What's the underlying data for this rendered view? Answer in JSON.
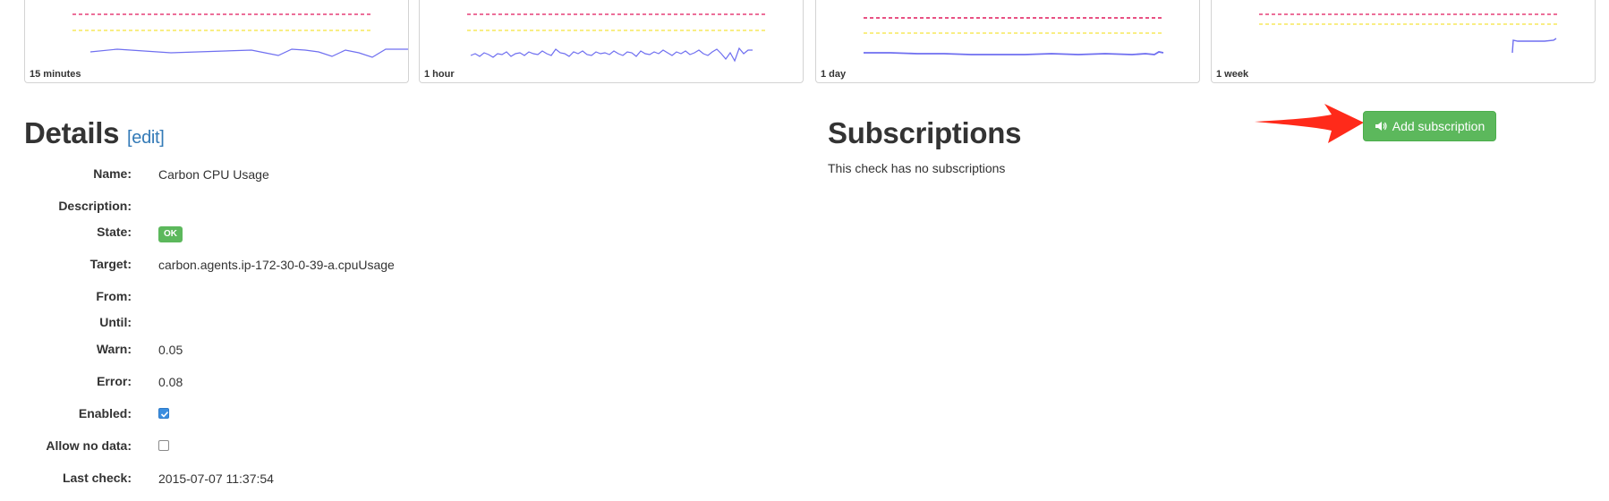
{
  "sparklines": [
    {
      "label": "15 minutes"
    },
    {
      "label": "1 hour"
    },
    {
      "label": "1 day"
    },
    {
      "label": "1 week"
    }
  ],
  "colors": {
    "error_line": "#e0195c",
    "warn_line": "#f5e33a",
    "series_line": "#6f6ff0",
    "accent_green": "#5cb85c",
    "link_blue": "#337ab7",
    "arrow_red": "#ff2a1a"
  },
  "details": {
    "title": "Details",
    "edit_label": "[edit]",
    "fields": {
      "name": {
        "label": "Name:",
        "value": "Carbon CPU Usage"
      },
      "description": {
        "label": "Description:",
        "value": ""
      },
      "state": {
        "label": "State:",
        "value": "OK"
      },
      "target": {
        "label": "Target:",
        "value": "carbon.agents.ip-172-30-0-39-a.cpuUsage"
      },
      "from": {
        "label": "From:",
        "value": ""
      },
      "until": {
        "label": "Until:",
        "value": ""
      },
      "warn": {
        "label": "Warn:",
        "value": "0.05"
      },
      "error": {
        "label": "Error:",
        "value": "0.08"
      },
      "enabled": {
        "label": "Enabled:",
        "checked": true
      },
      "allow_no_data": {
        "label": "Allow no data:",
        "checked": false
      },
      "last_check": {
        "label": "Last check:",
        "value": "2015-07-07 11:37:54"
      }
    }
  },
  "subscriptions": {
    "title": "Subscriptions",
    "empty_text": "This check has no subscriptions",
    "add_button": {
      "label": "Add subscription",
      "icon": "speaker-icon"
    }
  }
}
